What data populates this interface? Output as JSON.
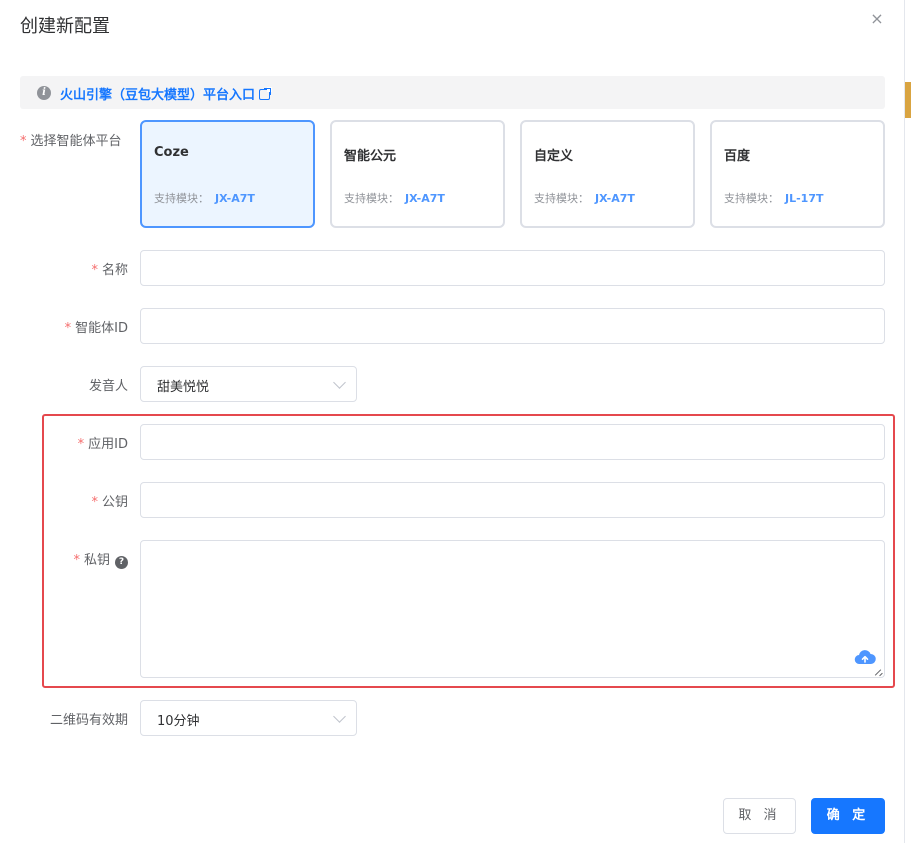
{
  "dialog": {
    "title": "创建新配置",
    "close_label": "×"
  },
  "notice": {
    "link_text": "火山引擎（豆包大模型）平台入口"
  },
  "platform": {
    "label": "选择智能体平台",
    "support_prefix": "支持模块：",
    "cards": [
      {
        "name": "Coze",
        "module": "JX-A7T",
        "selected": true
      },
      {
        "name": "智能公元",
        "module": "JX-A7T",
        "selected": false
      },
      {
        "name": "自定义",
        "module": "JX-A7T",
        "selected": false
      },
      {
        "name": "百度",
        "module": "JL-17T",
        "selected": false
      }
    ]
  },
  "form": {
    "name_label": "名称",
    "name_value": "",
    "agent_id_label": "智能体ID",
    "agent_id_value": "",
    "voice_label": "发音人",
    "voice_value": "甜美悦悦",
    "app_id_label": "应用ID",
    "app_id_value": "",
    "public_key_label": "公钥",
    "public_key_value": "",
    "private_key_label": "私钥",
    "private_key_value": "",
    "qr_label": "二维码有效期",
    "qr_value": "10分钟"
  },
  "footer": {
    "cancel_label": "取 消",
    "ok_label": "确 定"
  },
  "icons": {
    "info": "info-icon",
    "external": "external-link-icon",
    "help": "question-icon",
    "upload": "cloud-upload-icon",
    "chevron": "chevron-down-icon",
    "close": "close-icon"
  },
  "colors": {
    "primary": "#1677ff",
    "selected_card_border": "#4e96ff",
    "selected_card_bg": "#ecf5ff",
    "required": "#f56c6c",
    "highlight_box": "#e5484d"
  }
}
